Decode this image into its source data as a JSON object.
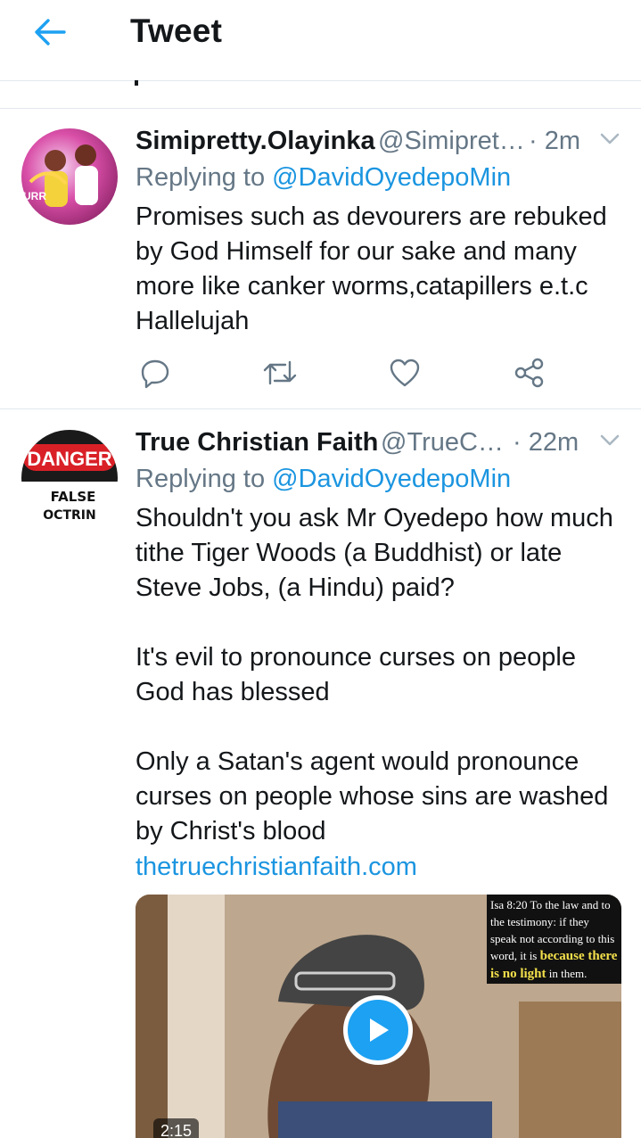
{
  "header": {
    "title": "Tweet",
    "back_icon": "arrow-left-icon",
    "accent": "#1da1f2"
  },
  "tweets": [
    {
      "name": "Simipretty.Olayinka",
      "handle": "@Simipret…",
      "time": "· 2m",
      "replying_prefix": "Replying to",
      "replying_to": "@DavidOyedepoMin",
      "body": "Promises such as devourers are rebuked by God Himself for our sake and many more like canker worms,catapillers e.t.c Hallelujah",
      "avatar_text": "URR"
    },
    {
      "name": "True Christian Faith",
      "handle": "@TrueC…",
      "time": "· 22m",
      "replying_prefix": "Replying to",
      "replying_to": "@DavidOyedepoMin",
      "body": "Shouldn't you ask Mr Oyedepo how much tithe Tiger Woods (a Buddhist) or late Steve Jobs, (a Hindu) paid?\n\nIt's evil to pronounce curses on people God has blessed\n\nOnly a Satan's agent would pronounce curses on people whose sins are washed by Christ's blood",
      "link": "thetruechristianfaith.com",
      "avatar_top": "DANGER",
      "avatar_line1": "FALSE",
      "avatar_line2": "OCTRIN",
      "media": {
        "overlay_prefix": "Isa 8:20  To the law and to the testimony: if they speak not according to this word, it is",
        "overlay_highlight": "because there is no light",
        "overlay_suffix": "in them.",
        "duration": "2:15"
      }
    }
  ]
}
